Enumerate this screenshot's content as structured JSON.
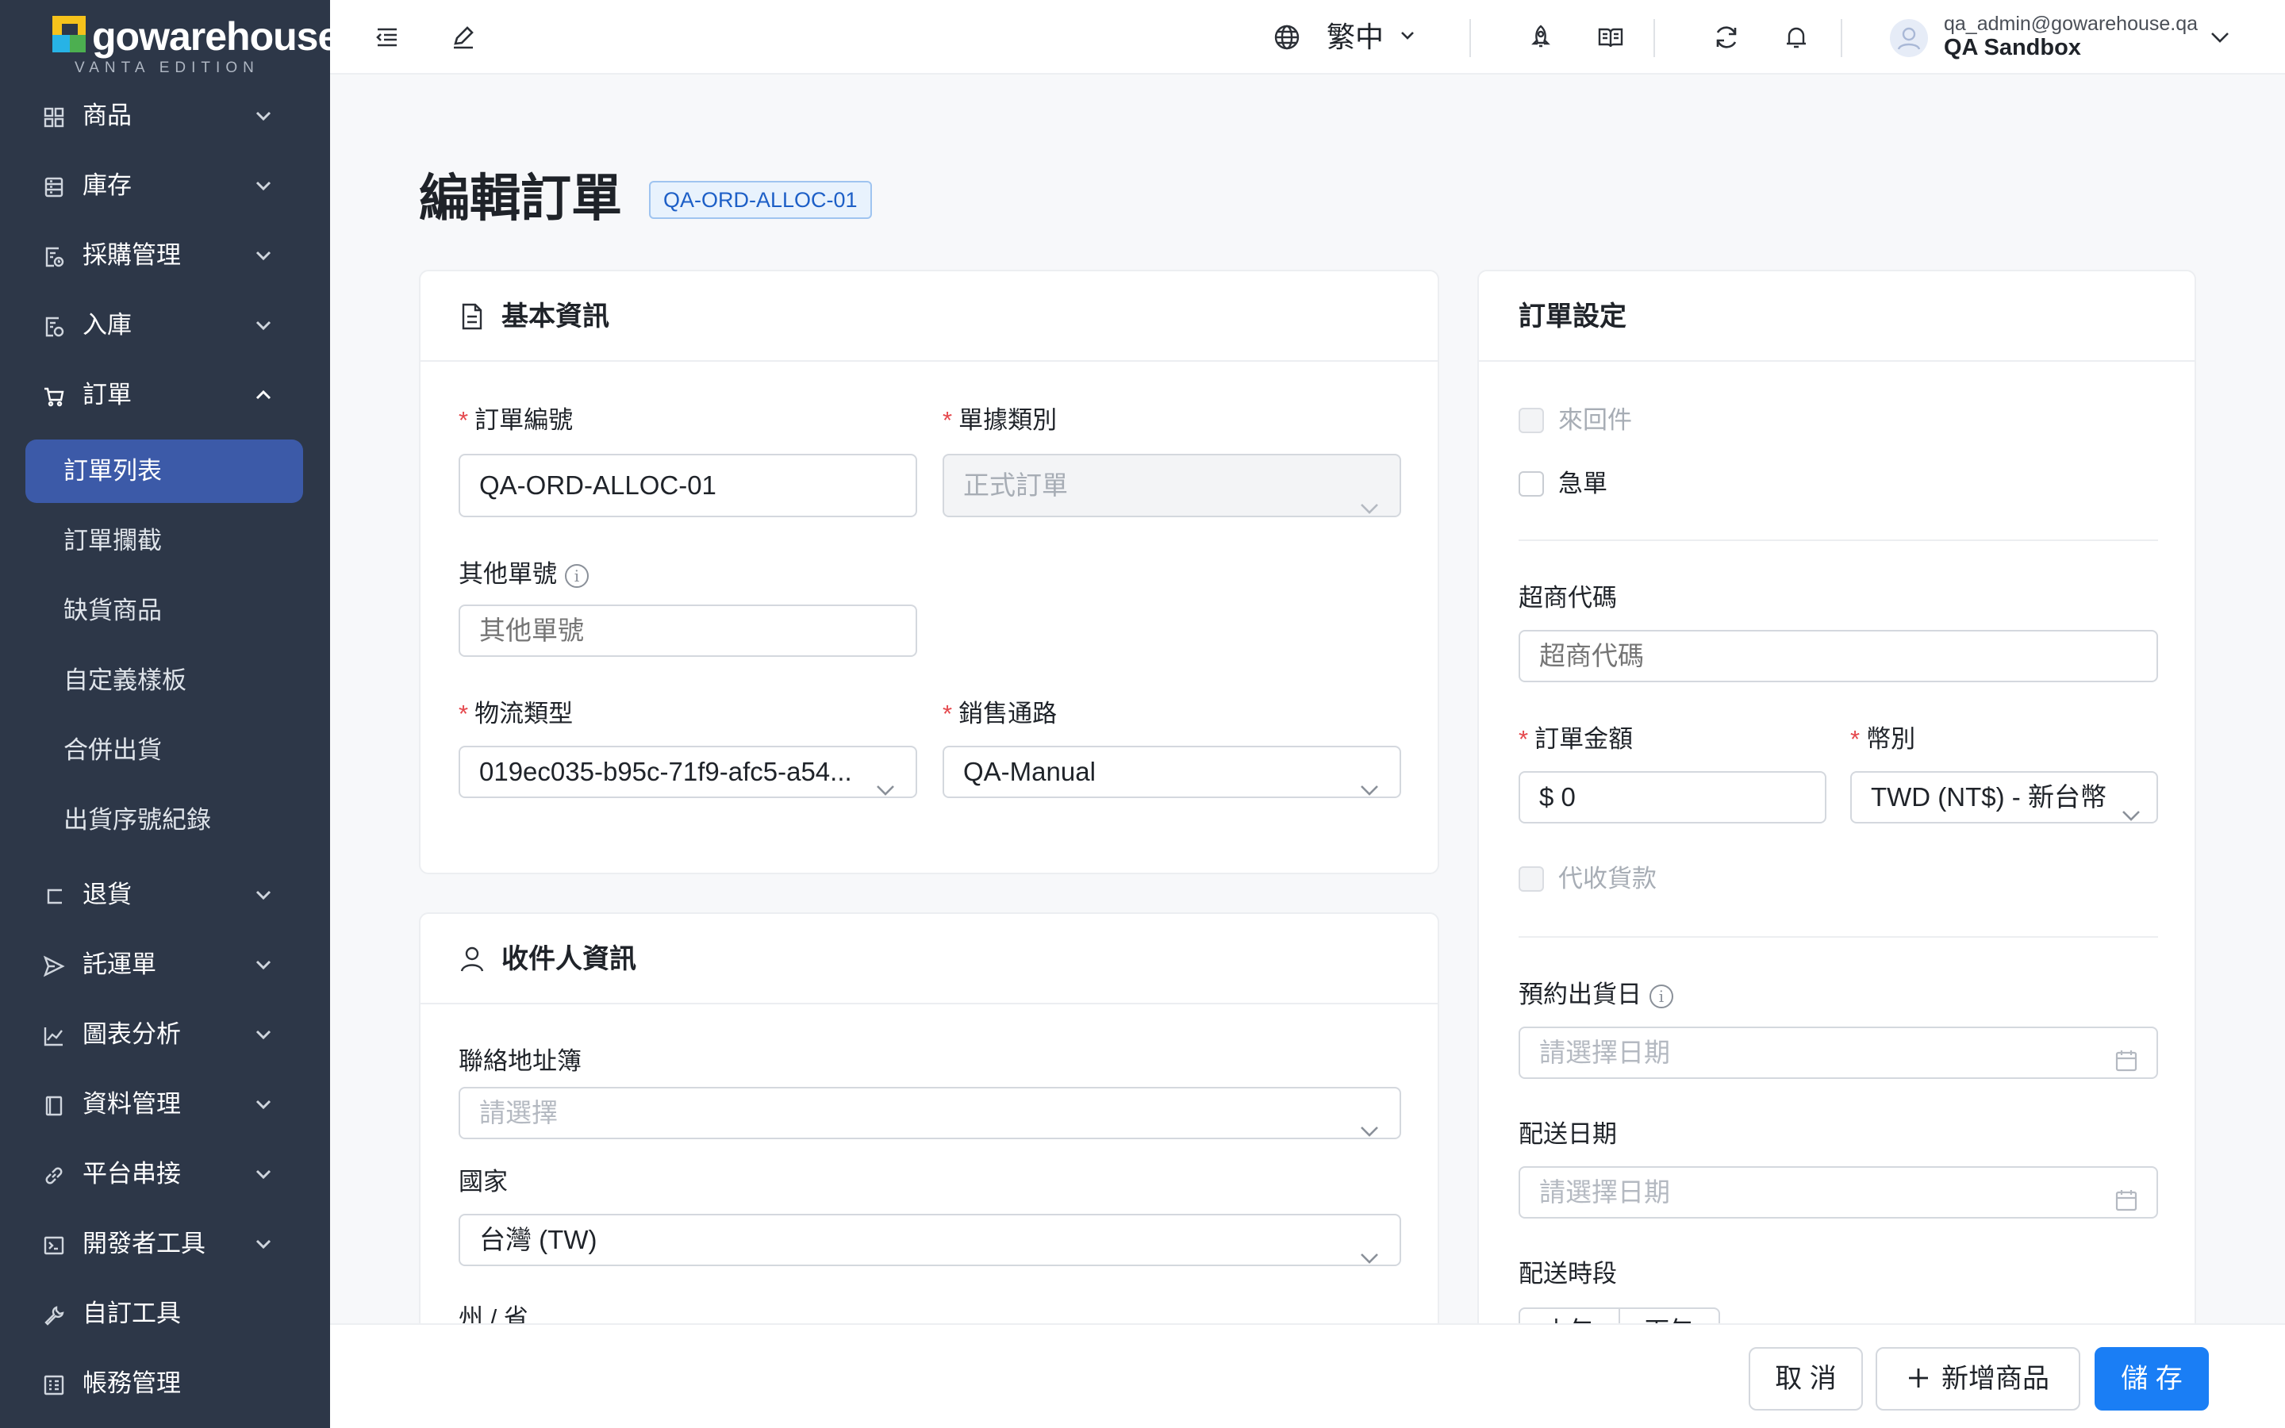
{
  "brand": {
    "name": "gowarehouse",
    "edition": "VANTA EDITION"
  },
  "sidebar": {
    "items": [
      {
        "label": "商品",
        "icon": "grid-icon"
      },
      {
        "label": "庫存",
        "icon": "inventory-icon"
      },
      {
        "label": "採購管理",
        "icon": "purchase-icon"
      },
      {
        "label": "入庫",
        "icon": "inbound-icon"
      },
      {
        "label": "訂單",
        "icon": "cart-icon"
      },
      {
        "label": "退貨",
        "icon": "return-icon"
      },
      {
        "label": "託運單",
        "icon": "send-icon"
      },
      {
        "label": "圖表分析",
        "icon": "chart-icon"
      },
      {
        "label": "資料管理",
        "icon": "book-icon"
      },
      {
        "label": "平台串接",
        "icon": "link-icon"
      },
      {
        "label": "開發者工具",
        "icon": "terminal-icon"
      },
      {
        "label": "自訂工具",
        "icon": "wrench-icon"
      },
      {
        "label": "帳務管理",
        "icon": "billing-icon"
      }
    ],
    "order_subitems": [
      "訂單列表",
      "訂單攔截",
      "缺貨商品",
      "自定義樣板",
      "合併出貨",
      "出貨序號紀錄"
    ],
    "active_subitem": "訂單列表"
  },
  "header": {
    "language": "繁中",
    "user_email": "qa_admin@gowarehouse.qa",
    "user_org": "QA Sandbox"
  },
  "page": {
    "title": "編輯訂單",
    "order_tag": "QA-ORD-ALLOC-01"
  },
  "basic_info": {
    "title": "基本資訊",
    "order_no_label": "訂單編號",
    "order_no_value": "QA-ORD-ALLOC-01",
    "doc_type_label": "單據類別",
    "doc_type_value": "正式訂單",
    "other_no_label": "其他單號",
    "other_no_placeholder": "其他單號",
    "logistics_label": "物流類型",
    "logistics_value": "019ec035-b95c-71f9-afc5-a54...",
    "channel_label": "銷售通路",
    "channel_value": "QA-Manual"
  },
  "recipient": {
    "title": "收件人資訊",
    "address_book_label": "聯絡地址簿",
    "address_book_placeholder": "請選擇",
    "country_label": "國家",
    "country_value": "台灣 (TW)",
    "state_label": "州 / 省"
  },
  "settings": {
    "title": "訂單設定",
    "round_trip_label": "來回件",
    "urgent_label": "急單",
    "store_code_label": "超商代碼",
    "store_code_placeholder": "超商代碼",
    "amount_label": "訂單金額",
    "amount_value": "$ 0",
    "currency_label": "幣別",
    "currency_value": "TWD (NT$) - 新台幣",
    "cod_label": "代收貨款",
    "ship_date_label": "預約出貨日",
    "ship_date_placeholder": "請選擇日期",
    "delivery_date_label": "配送日期",
    "delivery_date_placeholder": "請選擇日期",
    "delivery_slot_label": "配送時段",
    "slot_options": [
      "上午",
      "下午"
    ]
  },
  "footer": {
    "cancel": "取 消",
    "add_product": "新增商品",
    "save": "儲 存"
  },
  "colors": {
    "sidebar_bg": "#2d3748",
    "active_item": "#3c5aa8",
    "primary": "#1a7ef5",
    "required": "#e5484d"
  }
}
